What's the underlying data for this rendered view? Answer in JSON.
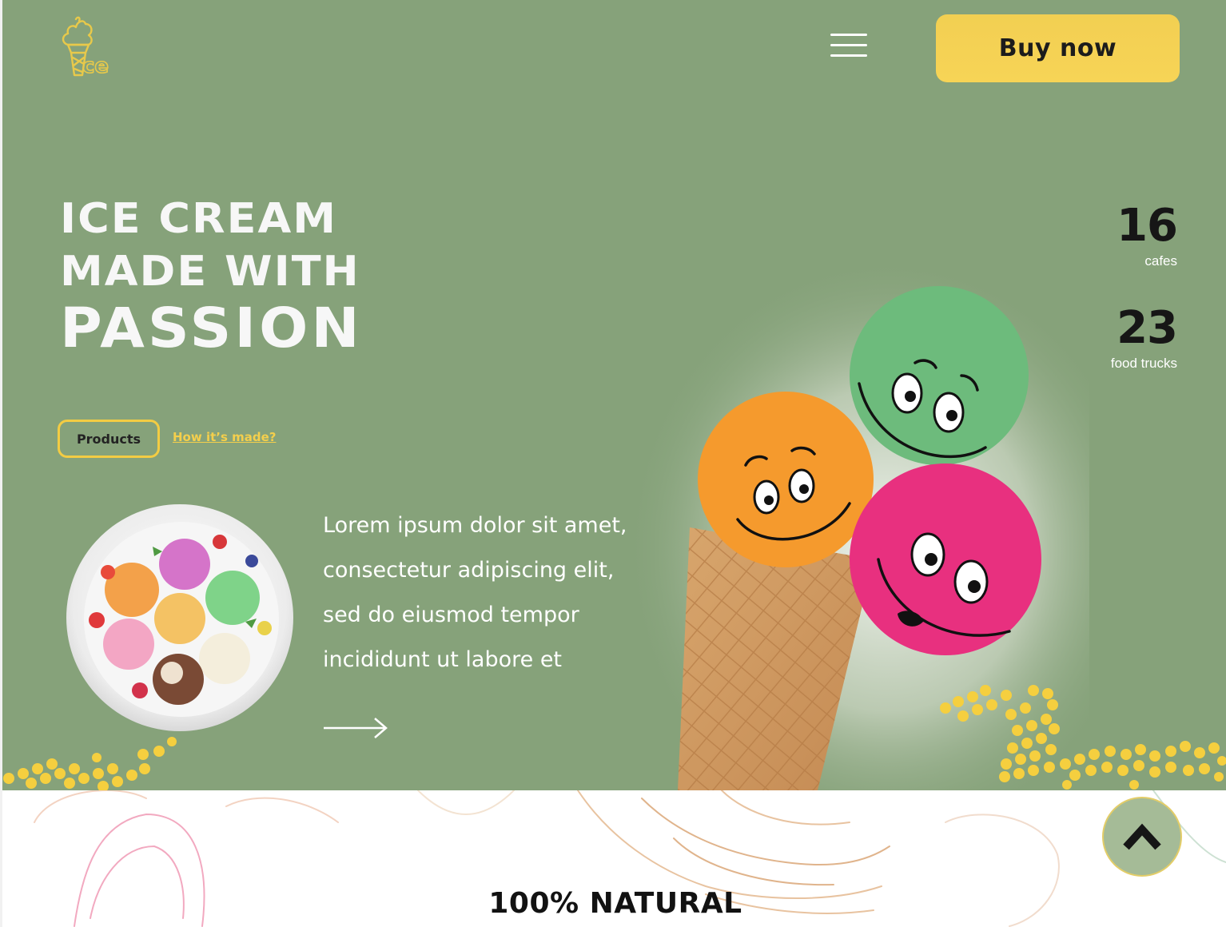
{
  "header": {
    "logo_text": "ce",
    "menu_icon": "hamburger-menu-icon",
    "buy_label": "Buy now"
  },
  "hero": {
    "headline": [
      "ICE CREAM",
      "MADE WITH",
      "PASSION"
    ],
    "products_label": "Products",
    "how_label": "How it’s made?",
    "description": "Lorem ipsum dolor sit amet, consectetur adipiscing elit, sed do eiusmod tempor incididunt ut labore et",
    "arrow_icon": "arrow-right-icon"
  },
  "stats": [
    {
      "value": "16",
      "label": "cafes"
    },
    {
      "value": "23",
      "label": "food trucks"
    }
  ],
  "section2": {
    "title": "100% NATURAL"
  },
  "scroll_top_icon": "chevron-up-icon",
  "colors": {
    "hero_bg": "#86a27a",
    "accent_yellow": "#f5d04f",
    "dark_text": "#161616"
  }
}
